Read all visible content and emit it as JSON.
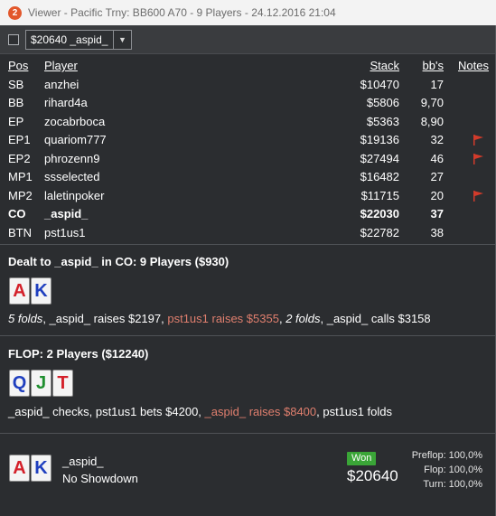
{
  "window": {
    "title": "Viewer - Pacific Trny: BB600 A70 - 9 Players - 24.12.2016 21:04",
    "app_icon": "2"
  },
  "toolbar": {
    "selected_player": "$20640 _aspid_"
  },
  "table": {
    "headers": {
      "pos": "Pos",
      "player": "Player",
      "stack": "Stack",
      "bbs": "bb's",
      "notes": "Notes"
    },
    "rows": [
      {
        "pos": "SB",
        "player": "anzhei",
        "stack": "$10470",
        "bbs": "17",
        "flag": false
      },
      {
        "pos": "BB",
        "player": "rihard4a",
        "stack": "$5806",
        "bbs": "9,70",
        "flag": false
      },
      {
        "pos": "EP",
        "player": "zocabrboca",
        "stack": "$5363",
        "bbs": "8,90",
        "flag": false
      },
      {
        "pos": "EP1",
        "player": "quariom777",
        "stack": "$19136",
        "bbs": "32",
        "flag": true
      },
      {
        "pos": "EP2",
        "player": "phrozenn9",
        "stack": "$27494",
        "bbs": "46",
        "flag": true
      },
      {
        "pos": "MP1",
        "player": "ssselected",
        "stack": "$16482",
        "bbs": "27",
        "flag": false
      },
      {
        "pos": "MP2",
        "player": "laletinpoker",
        "stack": "$11715",
        "bbs": "20",
        "flag": true
      },
      {
        "pos": "CO",
        "player": "_aspid_",
        "stack": "$22030",
        "bbs": "37",
        "flag": false,
        "bold": true
      },
      {
        "pos": "BTN",
        "player": "pst1us1",
        "stack": "$22782",
        "bbs": "38",
        "flag": false
      }
    ]
  },
  "preflop": {
    "title": "Dealt to _aspid_ in CO: 9 Players ($930)",
    "cards": [
      {
        "rank": "A",
        "color": "#d4202a"
      },
      {
        "rank": "K",
        "color": "#1f3fbf"
      }
    ],
    "actions": [
      {
        "text": "5 folds",
        "style": "it"
      },
      {
        "text": ", _aspid_ raises $2197, ",
        "style": ""
      },
      {
        "text": "pst1us1 raises $5355",
        "style": "hl"
      },
      {
        "text": ", ",
        "style": ""
      },
      {
        "text": "2 folds",
        "style": "it"
      },
      {
        "text": ", _aspid_ calls $3158",
        "style": ""
      }
    ]
  },
  "flop": {
    "title": "FLOP: 2 Players ($12240)",
    "cards": [
      {
        "rank": "Q",
        "color": "#1f3fbf"
      },
      {
        "rank": "J",
        "color": "#1f8f2f"
      },
      {
        "rank": "T",
        "color": "#d4202a"
      }
    ],
    "actions": [
      {
        "text": "_aspid_ checks, pst1us1 bets $4200, ",
        "style": ""
      },
      {
        "text": "_aspid_ raises $8400",
        "style": "hl"
      },
      {
        "text": ", pst1us1 folds",
        "style": ""
      }
    ]
  },
  "result": {
    "cards": [
      {
        "rank": "A",
        "color": "#d4202a"
      },
      {
        "rank": "K",
        "color": "#1f3fbf"
      }
    ],
    "player": "_aspid_",
    "status": "No Showdown",
    "won_label": "Won",
    "amount": "$20640",
    "equity": [
      "Preflop: 100,0%",
      "Flop: 100,0%",
      "Turn: 100,0%"
    ]
  }
}
